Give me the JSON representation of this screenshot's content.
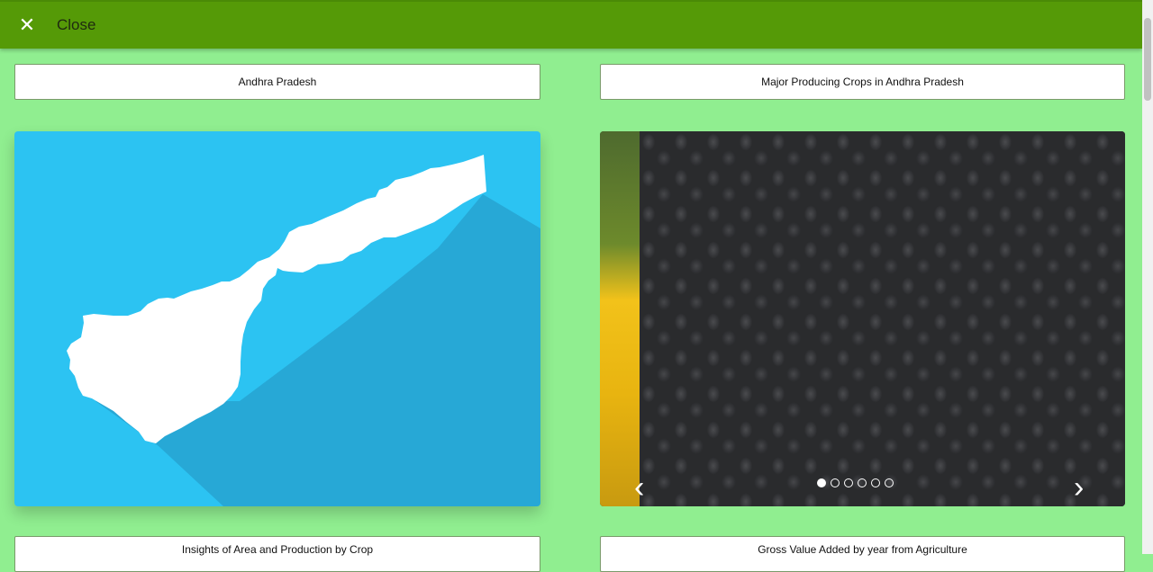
{
  "header": {
    "close_icon": "✕",
    "close_label": "Close"
  },
  "cards": {
    "state_name": "Andhra Pradesh",
    "crops_title": "Major Producing Crops in Andhra Pradesh",
    "insights_title": "Insights of Area and Production by Crop",
    "gva_title": "Gross Value Added by year from Agriculture"
  },
  "carousel": {
    "prev_icon": "‹",
    "next_icon": "›",
    "slide_count": 6,
    "active_slide": 1
  },
  "colors": {
    "background": "#90ee90",
    "header": "#559a07",
    "map_background": "#2cc3f2",
    "map_shape": "#ffffff"
  }
}
